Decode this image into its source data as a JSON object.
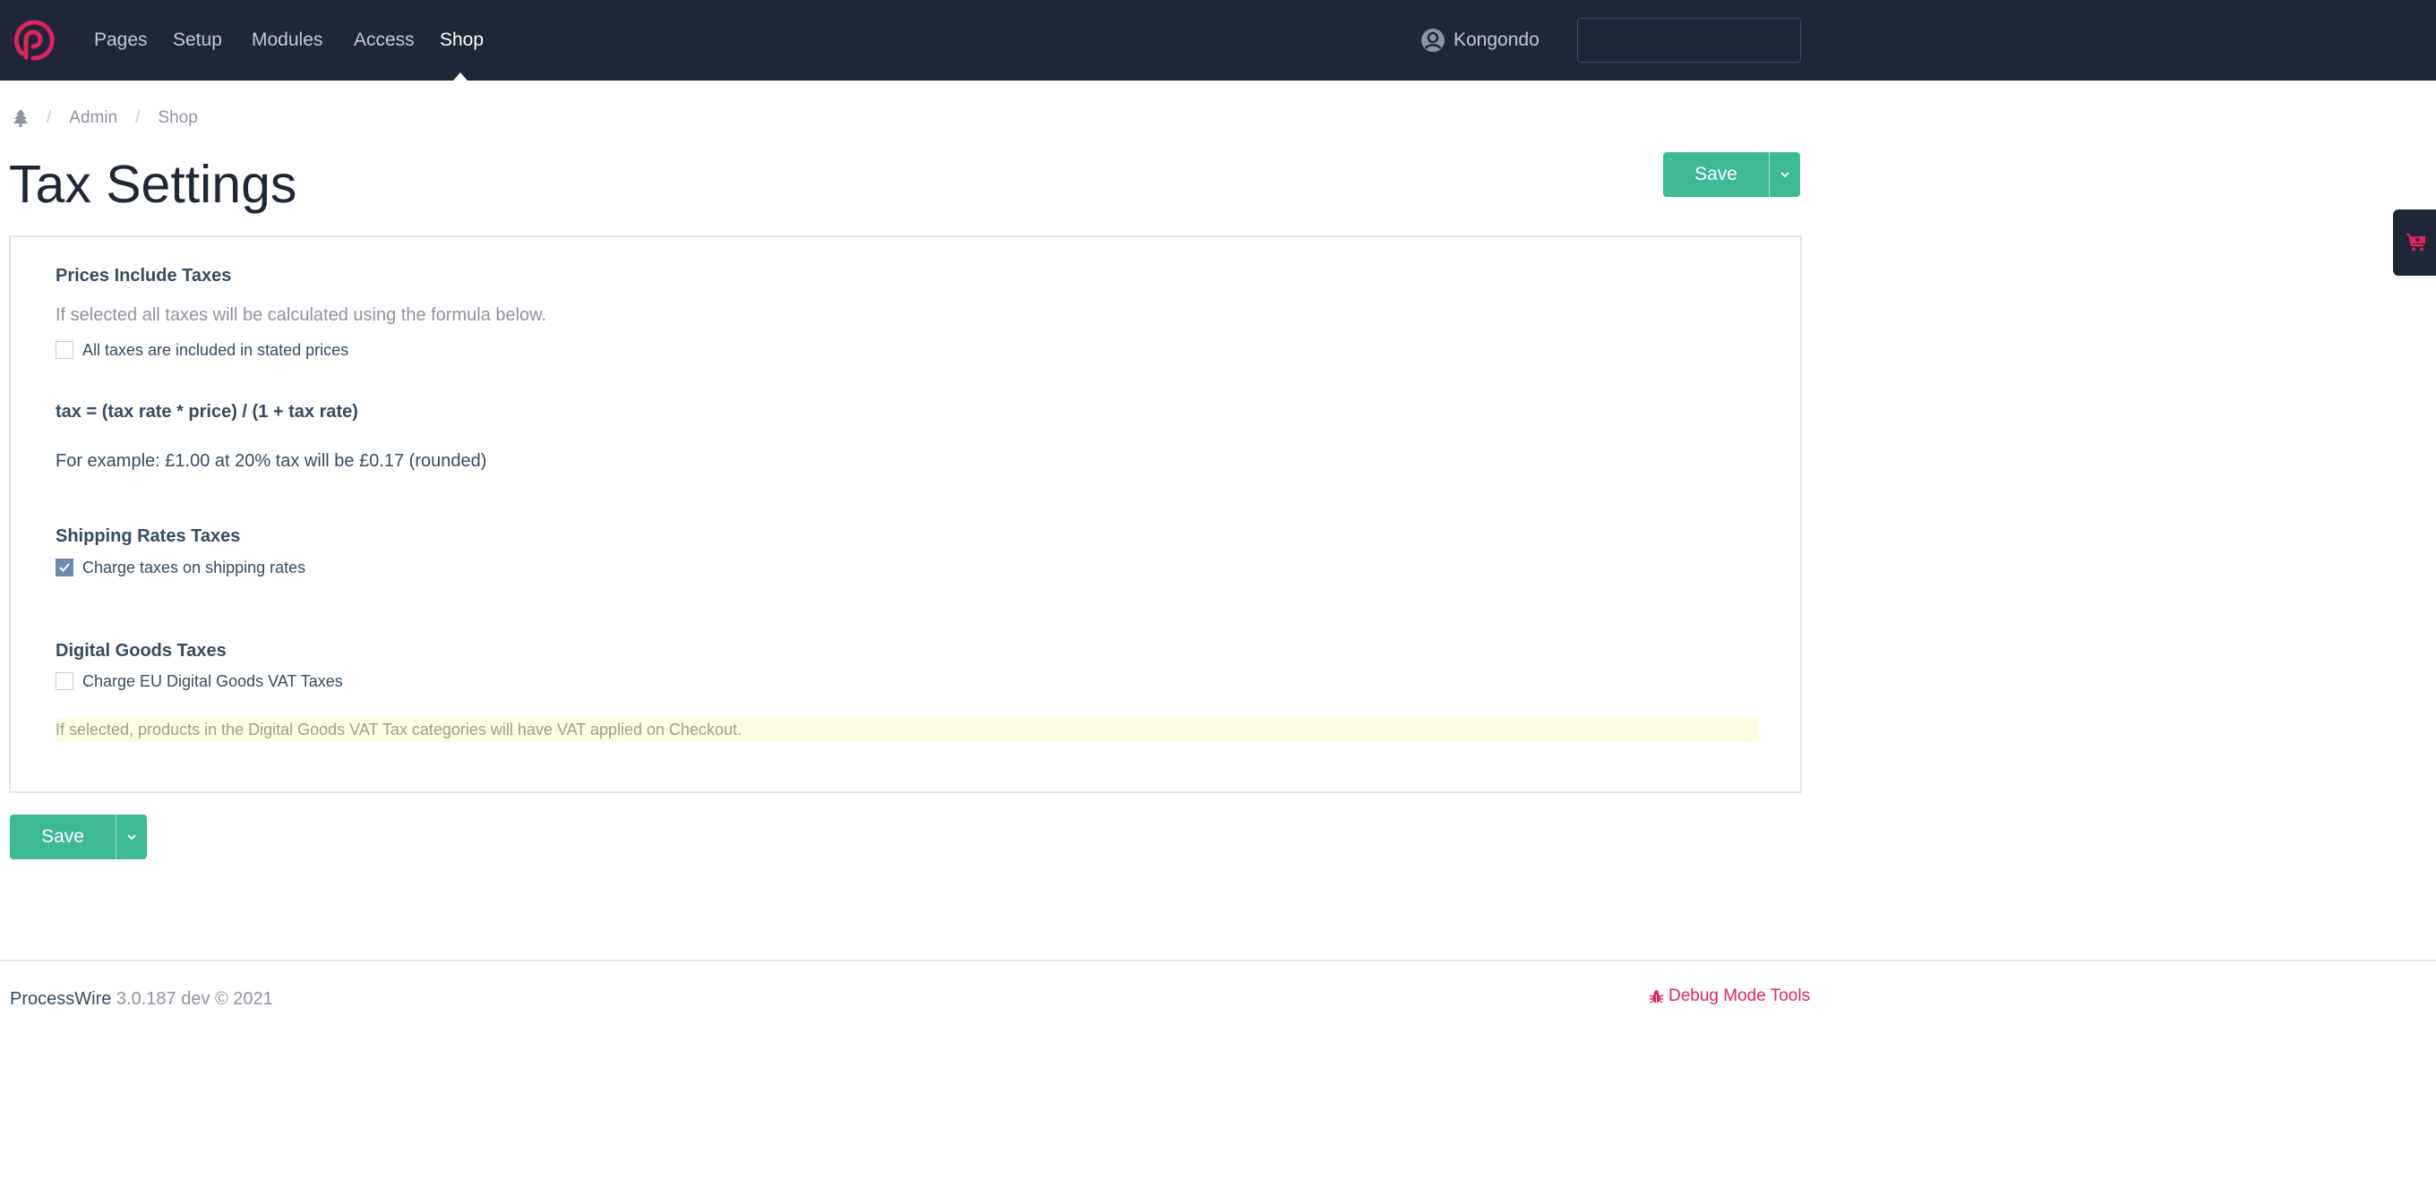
{
  "colors": {
    "header_bg": "#1e2735",
    "brand": "#e0245e",
    "save_green": "#3eb996",
    "checkbox_checked": "#6b8aad",
    "notice_bg": "#fefde2"
  },
  "header": {
    "logo_icon": "processwire-logo-icon",
    "nav": [
      {
        "label": "Pages",
        "active": false
      },
      {
        "label": "Setup",
        "active": false
      },
      {
        "label": "Modules",
        "active": false
      },
      {
        "label": "Access",
        "active": false
      },
      {
        "label": "Shop",
        "active": true
      }
    ],
    "user": {
      "icon": "user-circle-icon",
      "name": "Kongondo"
    },
    "search": {
      "icon": "search-icon",
      "value": "",
      "placeholder": ""
    }
  },
  "breadcrumb": {
    "home_icon": "tree-icon",
    "items": [
      "Admin",
      "Shop"
    ],
    "separator": "/"
  },
  "page": {
    "title": "Tax Settings",
    "save_label": "Save",
    "save_dropdown_icon": "chevron-down-icon"
  },
  "sections": {
    "prices": {
      "title": "Prices Include Taxes",
      "description": "If selected all taxes will be calculated using the formula below.",
      "checkbox_label": "All taxes are included in stated prices",
      "checked": false,
      "formula": "tax = (tax rate * price) / (1 + tax rate)",
      "example": "For example: £1.00 at 20% tax will be £0.17 (rounded)"
    },
    "shipping": {
      "title": "Shipping Rates Taxes",
      "checkbox_label": "Charge taxes on shipping rates",
      "checked": true
    },
    "digital": {
      "title": "Digital Goods Taxes",
      "checkbox_label": "Charge EU Digital Goods VAT Taxes",
      "checked": false,
      "notice": "If selected, products in the Digital Goods VAT Tax categories will have VAT applied on Checkout."
    }
  },
  "footer": {
    "brand": "ProcessWire",
    "version": "3.0.187 dev © 2021",
    "debug_label": "Debug Mode Tools",
    "debug_icon": "bug-icon"
  },
  "side_tab": {
    "icon": "cart-plus-icon"
  }
}
